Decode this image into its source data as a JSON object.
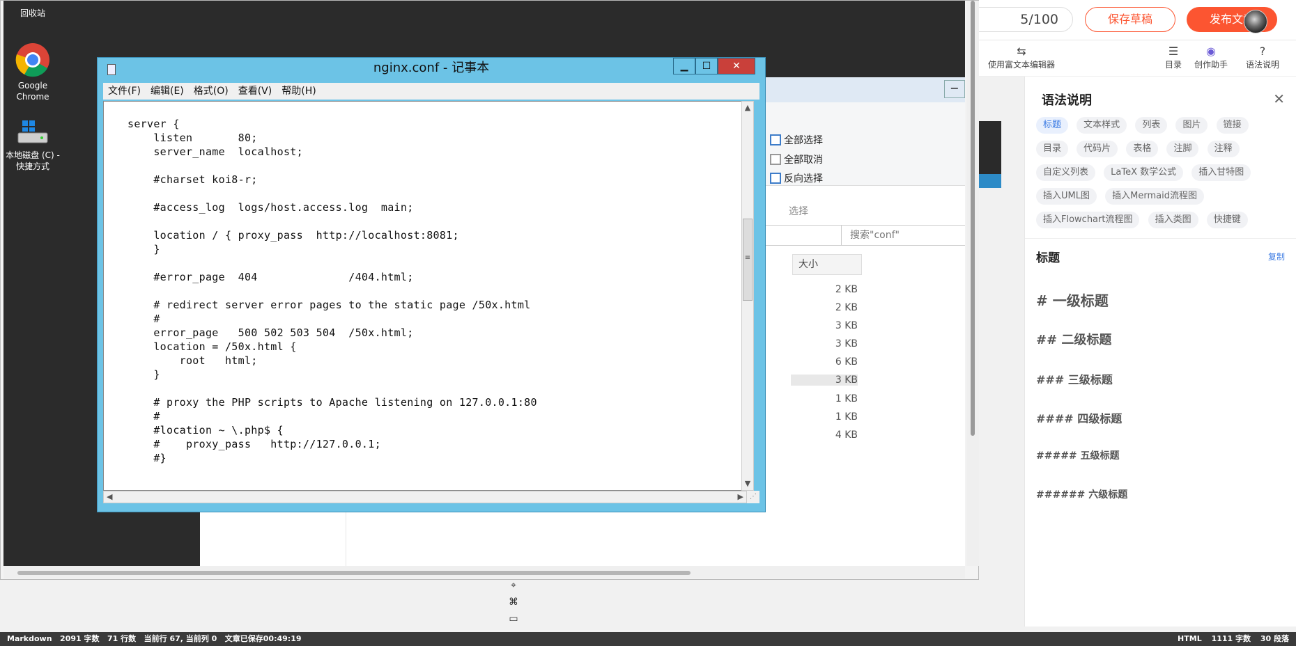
{
  "desktop": {
    "icons": [
      {
        "name": "recycle-bin",
        "label": "回收站"
      },
      {
        "name": "google-chrome",
        "label": "Google Chrome"
      },
      {
        "name": "local-disk",
        "label": "本地磁盘 (C) - 快捷方式"
      }
    ]
  },
  "explorer": {
    "select_all": "全部选择",
    "select_none": "全部取消",
    "invert_selection": "反向选择",
    "group_label": "选择",
    "search_placeholder": "搜索\"conf\"",
    "col_size": "大小",
    "file_sizes": [
      "2 KB",
      "2 KB",
      "3 KB",
      "3 KB",
      "6 KB",
      "3 KB",
      "1 KB",
      "1 KB",
      "4 KB"
    ]
  },
  "notepad": {
    "title": "nginx.conf - 记事本",
    "menu": [
      "文件(F)",
      "编辑(E)",
      "格式(O)",
      "查看(V)",
      "帮助(H)"
    ],
    "content": "server {\n    listen       80;\n    server_name  localhost;\n\n    #charset koi8-r;\n\n    #access_log  logs/host.access.log  main;\n\n    location / { proxy_pass  http://localhost:8081;\n    }\n\n    #error_page  404              /404.html;\n\n    # redirect server error pages to the static page /50x.html\n    #\n    error_page   500 502 503 504  /50x.html;\n    location = /50x.html {\n        root   html;\n    }\n\n    # proxy the PHP scripts to Apache listening on 127.0.0.1:80\n    #\n    #location ~ \\.php$ {\n    #    proxy_pass   http://127.0.0.1;\n    #}"
  },
  "editor": {
    "word_count": "5/100",
    "save_draft": "保存草稿",
    "publish": "发布文章",
    "toolbar": {
      "rich_text": "使用富文本编辑器",
      "toc": "目录",
      "assistant": "创作助手",
      "syntax_help": "语法说明"
    }
  },
  "help_panel": {
    "title": "语法说明",
    "chips": [
      "标题",
      "文本样式",
      "列表",
      "图片",
      "链接",
      "目录",
      "代码片",
      "表格",
      "注脚",
      "注释",
      "自定义列表",
      "LaTeX 数学公式",
      "插入甘特图",
      "插入UML图",
      "插入Mermaid流程图",
      "插入Flowchart流程图",
      "插入类图",
      "快捷键"
    ],
    "section_title": "标题",
    "copy": "复制",
    "headings": [
      "# 一级标题",
      "## 二级标题",
      "### 三级标题",
      "#### 四级标题",
      "##### 五级标题",
      "###### 六级标题"
    ]
  },
  "status_bar": {
    "mode": "Markdown",
    "words": "2091 字数",
    "lines": "71 行数",
    "cursor": "当前行 67, 当前列 0",
    "saved": "文章已保存00:49:19",
    "right_mode": "HTML",
    "right_words": "1111 字数",
    "right_paragraphs": "30 段落"
  },
  "colors": {
    "accent": "#fc5531",
    "link": "#3a7ae3",
    "notepad_frame": "#6cc3e6"
  }
}
